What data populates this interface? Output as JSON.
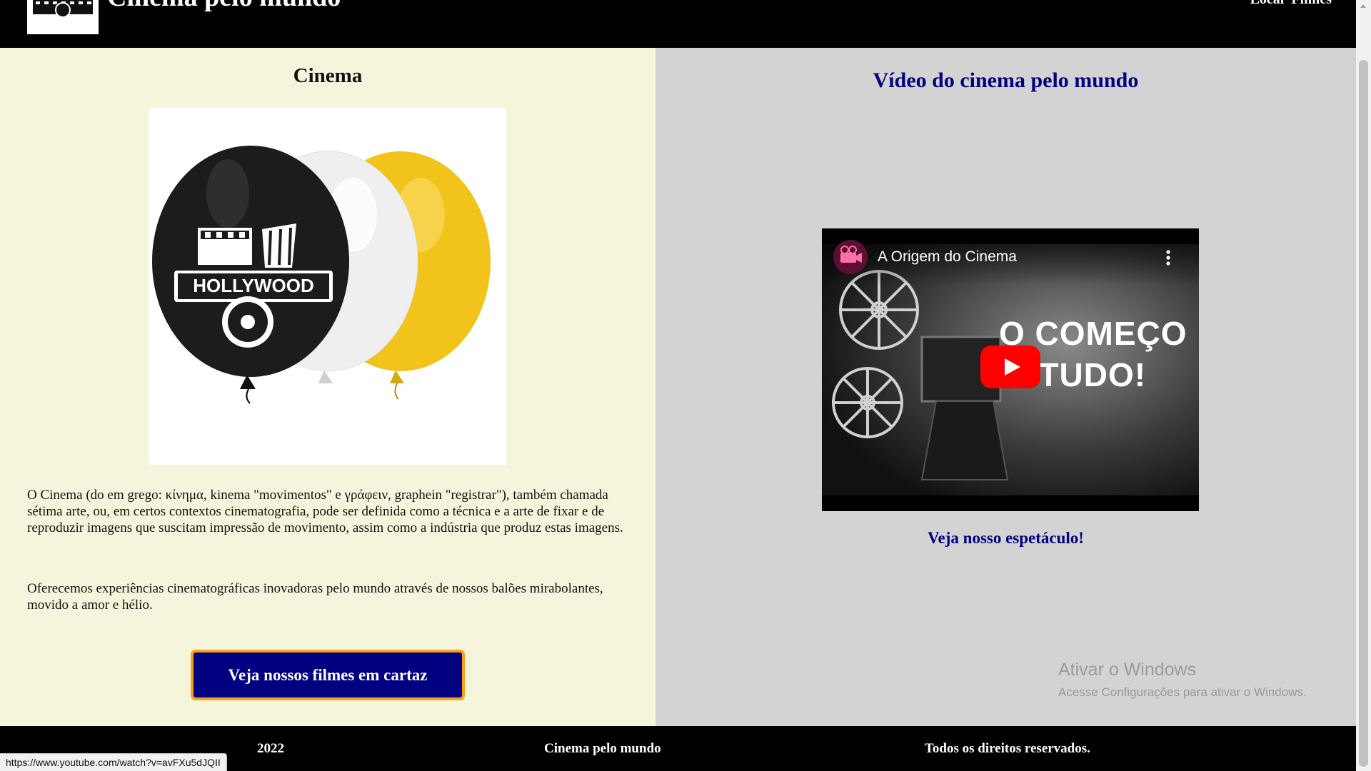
{
  "header": {
    "site_title": "Cinema pelo mundo",
    "nav": [
      "Local",
      "Filmes"
    ]
  },
  "left": {
    "title": "Cinema",
    "paragraph1": "O Cinema (do em grego: κίνημα, kinema \"movimentos\" e γράφειν, graphein \"registrar\"), também chamada sétima arte, ou, em certos contextos cinematografia, pode ser definida como a técnica e a arte de fixar e de reproduzir imagens que suscitam impressão de movimento, assim como a indústria que produz estas imagens.",
    "paragraph2": "Oferecemos experiências cinematográficas inovadoras pelo mundo através de nossos balões mirabolantes, movido a amor e hélio.",
    "button_label": "Veja nossos filmes em cartaz",
    "image_text": "HOLLYWOOD"
  },
  "right": {
    "title": "Vídeo do cinema pelo mundo",
    "video": {
      "title": "A Origem do Cinema",
      "overlay_line1": "O COMEÇO",
      "overlay_line2": "E TUDO!"
    },
    "link": "Veja nosso espetáculo!",
    "watermark_title": "Ativar o Windows",
    "watermark_subtitle": "Acesse Configurações para ativar o Windows."
  },
  "footer": {
    "year": "2022",
    "name": "Cinema pelo mundo",
    "rights": "Todos os direitos reservados."
  },
  "status_url": "https://www.youtube.com/watch?v=avFXu5dJQII",
  "colors": {
    "left_bg": "#f5f5dc",
    "right_bg": "#d3d3d3",
    "accent_navy": "#000080",
    "button_border": "#f7a21a",
    "youtube_red": "#ff0000"
  }
}
